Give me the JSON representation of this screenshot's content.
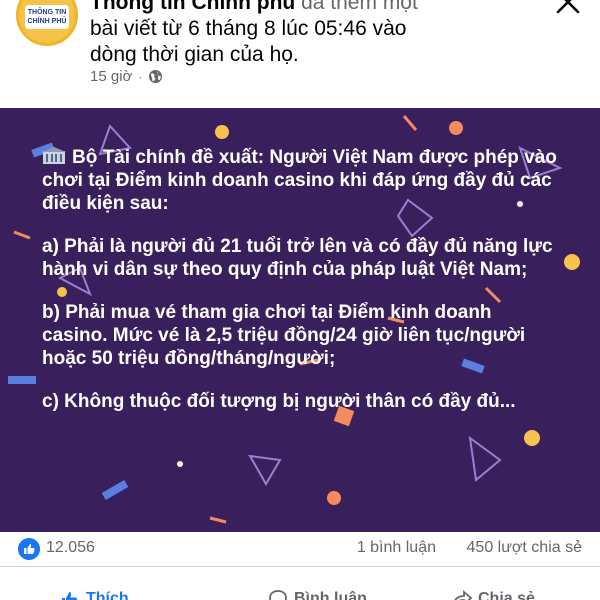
{
  "post": {
    "avatar_text": "THÔNG TIN CHÍNH PHỦ",
    "header_line1_author": "Thông tin Chính phủ",
    "header_line1_rest": " đã thêm một",
    "header_line2": "bài viết từ 6 tháng 8 lúc 05:46 vào",
    "header_line3": "dòng thời gian của họ.",
    "time": "15 giờ",
    "separator": "·",
    "privacy_icon": "globe-icon",
    "close_icon": "close-icon"
  },
  "banner": {
    "background": "#3a1f5d",
    "intro": "Bộ Tài chính đề xuất: Người Việt Nam được phép vào chơi tại Điểm kinh doanh casino khi đáp ứng đầy đủ các điều kiện sau:",
    "item_a": "a) Phải là người đủ 21 tuổi trở lên và có đầy đủ năng lực hành vi dân sự theo quy định của pháp luật Việt Nam;",
    "item_b": "b) Phải mua vé tham gia chơi tại Điểm kinh doanh casino. Mức vé là 2,5 triệu đồng/24 giờ liên tục/người hoặc 50 triệu đồng/tháng/người;",
    "item_c": "c) Không thuộc đối tượng bị người thân có đầy đủ..."
  },
  "stats": {
    "reaction_icon": "like-icon",
    "likes": "12.056",
    "comments": "1 bình luận",
    "shares": "450 lượt chia sẻ"
  },
  "actions": {
    "like": "Thích",
    "comment": "Bình luận",
    "share": "Chia sẻ"
  },
  "colors": {
    "accent": "#1877f2",
    "muted": "#65676b"
  }
}
